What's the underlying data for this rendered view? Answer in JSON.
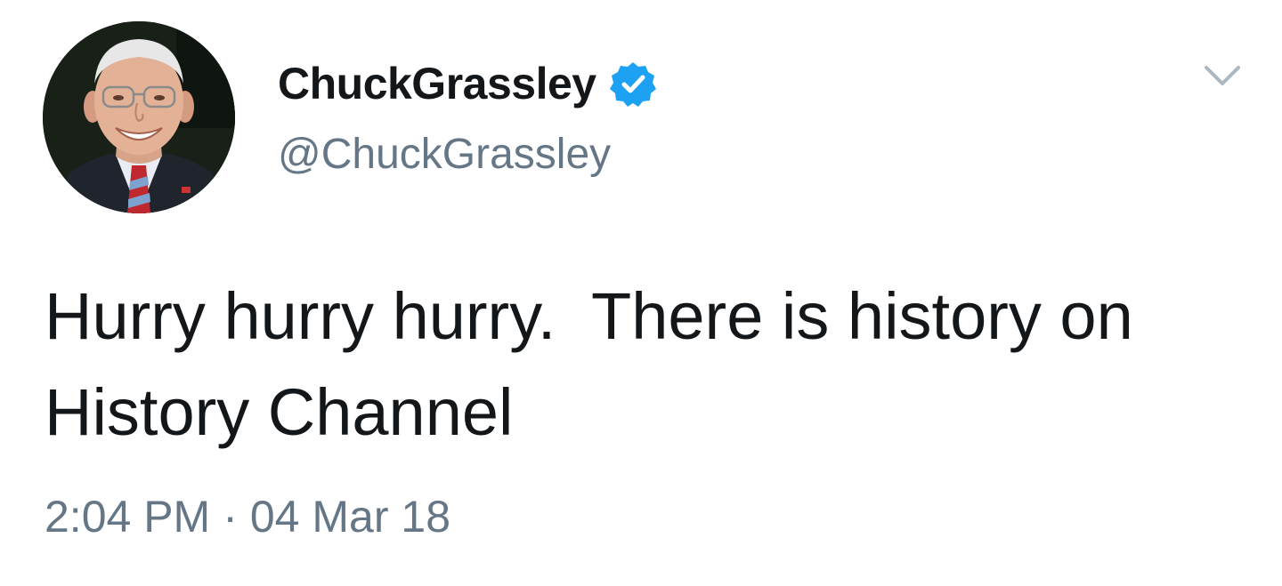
{
  "tweet": {
    "author": {
      "display_name": "ChuckGrassley",
      "handle": "@ChuckGrassley",
      "verified": true,
      "avatar_icon": "profile-photo"
    },
    "text": "Hurry hurry hurry.  There is history on History Channel",
    "time": "2:04 PM",
    "separator": "·",
    "date": "04 Mar 18",
    "menu_icon": "chevron-down-icon"
  },
  "colors": {
    "primary_text": "#14171a",
    "secondary_text": "#657786",
    "verified_badge": "#1da1f2",
    "chevron": "#aab8c2",
    "background": "#ffffff"
  }
}
